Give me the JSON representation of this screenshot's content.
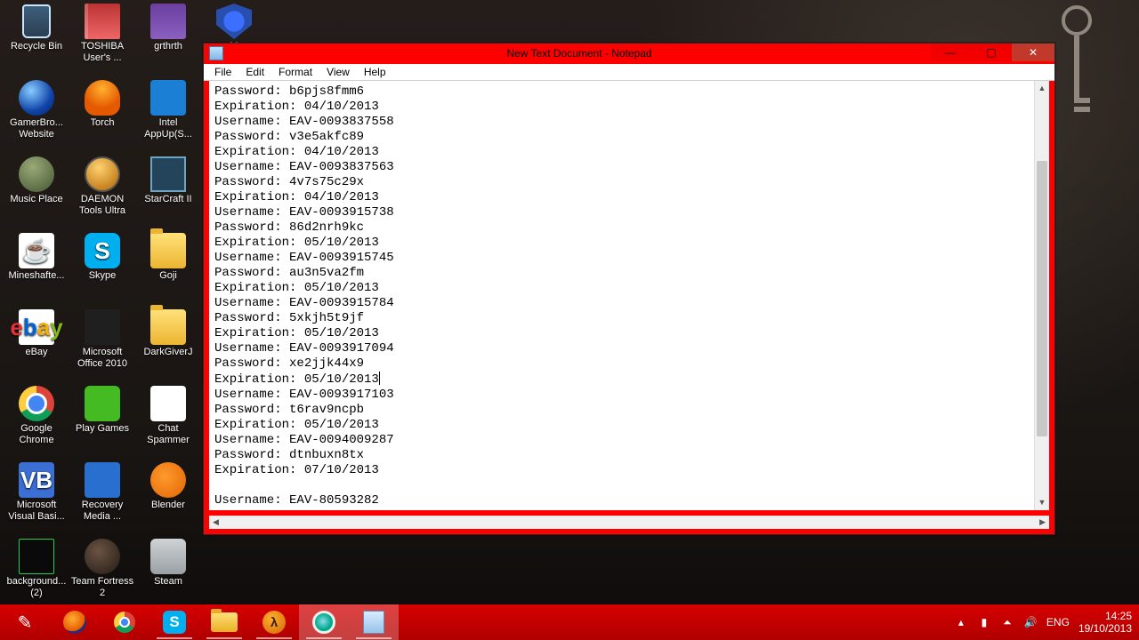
{
  "desktop": {
    "icons": [
      {
        "label": "Recycle Bin",
        "icon": "bin"
      },
      {
        "label": "TOSHIBA User's ...",
        "icon": "book"
      },
      {
        "label": "grthrth",
        "icon": "winrar"
      },
      {
        "label": "99",
        "icon": "shield"
      },
      {
        "label": "GamerBro... Website",
        "icon": "globe"
      },
      {
        "label": "Torch",
        "icon": "torch"
      },
      {
        "label": "Intel AppUp(S...",
        "icon": "intel"
      },
      {
        "label": "",
        "icon": ""
      },
      {
        "label": "Music Place",
        "icon": "head"
      },
      {
        "label": "DAEMON Tools Ultra",
        "icon": "daemon"
      },
      {
        "label": "StarCraft II",
        "icon": "sc"
      },
      {
        "label": "",
        "icon": ""
      },
      {
        "label": "Mineshafte...",
        "icon": "java"
      },
      {
        "label": "Skype",
        "icon": "skype"
      },
      {
        "label": "Goji",
        "icon": "folder"
      },
      {
        "label": "",
        "icon": ""
      },
      {
        "label": "eBay",
        "icon": "ebay"
      },
      {
        "label": "Microsoft Office 2010",
        "icon": "office"
      },
      {
        "label": "DarkGiverJ",
        "icon": "folder"
      },
      {
        "label": "",
        "icon": ""
      },
      {
        "label": "Google Chrome",
        "icon": "chrome"
      },
      {
        "label": "Play Games",
        "icon": "play"
      },
      {
        "label": "Chat Spammer",
        "icon": "chat"
      },
      {
        "label": "",
        "icon": ""
      },
      {
        "label": "Microsoft Visual Basi...",
        "icon": "vb"
      },
      {
        "label": "Recovery Media ...",
        "icon": "recov"
      },
      {
        "label": "Blender",
        "icon": "blender"
      },
      {
        "label": "",
        "icon": ""
      },
      {
        "label": "background... (2)",
        "icon": "bg"
      },
      {
        "label": "Team Fortress 2",
        "icon": "tf"
      },
      {
        "label": "Steam",
        "icon": "steam"
      },
      {
        "label": "",
        "icon": ""
      }
    ]
  },
  "notepad": {
    "title": "New Text Document - Notepad",
    "menu": [
      "File",
      "Edit",
      "Format",
      "View",
      "Help"
    ],
    "lines": [
      "Password: b6pjs8fmm6",
      "Expiration: 04/10/2013",
      "Username: EAV-0093837558",
      "Password: v3e5akfc89",
      "Expiration: 04/10/2013",
      "Username: EAV-0093837563",
      "Password: 4v7s75c29x",
      "Expiration: 04/10/2013",
      "Username: EAV-0093915738",
      "Password: 86d2nrh9kc",
      "Expiration: 05/10/2013",
      "Username: EAV-0093915745",
      "Password: au3n5va2fm",
      "Expiration: 05/10/2013",
      "Username: EAV-0093915784",
      "Password: 5xkjh5t9jf",
      "Expiration: 05/10/2013",
      "Username: EAV-0093917094",
      "Password: xe2jjk44x9",
      "Expiration: 05/10/2013 ",
      "Username: EAV-0093917103",
      "Password: t6rav9ncpb",
      "Expiration: 05/10/2013",
      "Username: EAV-0094009287",
      "Password: dtnbuxn8tx",
      "Expiration: 07/10/2013",
      "",
      "Username: EAV-80593282"
    ],
    "caret_line": 19
  },
  "taskbar": {
    "items": [
      {
        "name": "start",
        "icon": "stylus"
      },
      {
        "name": "firefox",
        "icon": "ff"
      },
      {
        "name": "chrome",
        "icon": "chrome"
      },
      {
        "name": "skype",
        "icon": "skype",
        "running": true
      },
      {
        "name": "explorer",
        "icon": "explorer",
        "running": true
      },
      {
        "name": "half-life",
        "icon": "hl",
        "running": true
      },
      {
        "name": "camera",
        "icon": "cam",
        "active": true,
        "running": true
      },
      {
        "name": "notepad",
        "icon": "note",
        "active": true,
        "running": true
      }
    ],
    "tray": {
      "lang": "ENG",
      "time": "14:25",
      "date": "19/10/2013",
      "up_glyph": "▴",
      "net_glyph": "▮",
      "wifi_glyph": "⏶",
      "vol_glyph": "🔊"
    }
  }
}
